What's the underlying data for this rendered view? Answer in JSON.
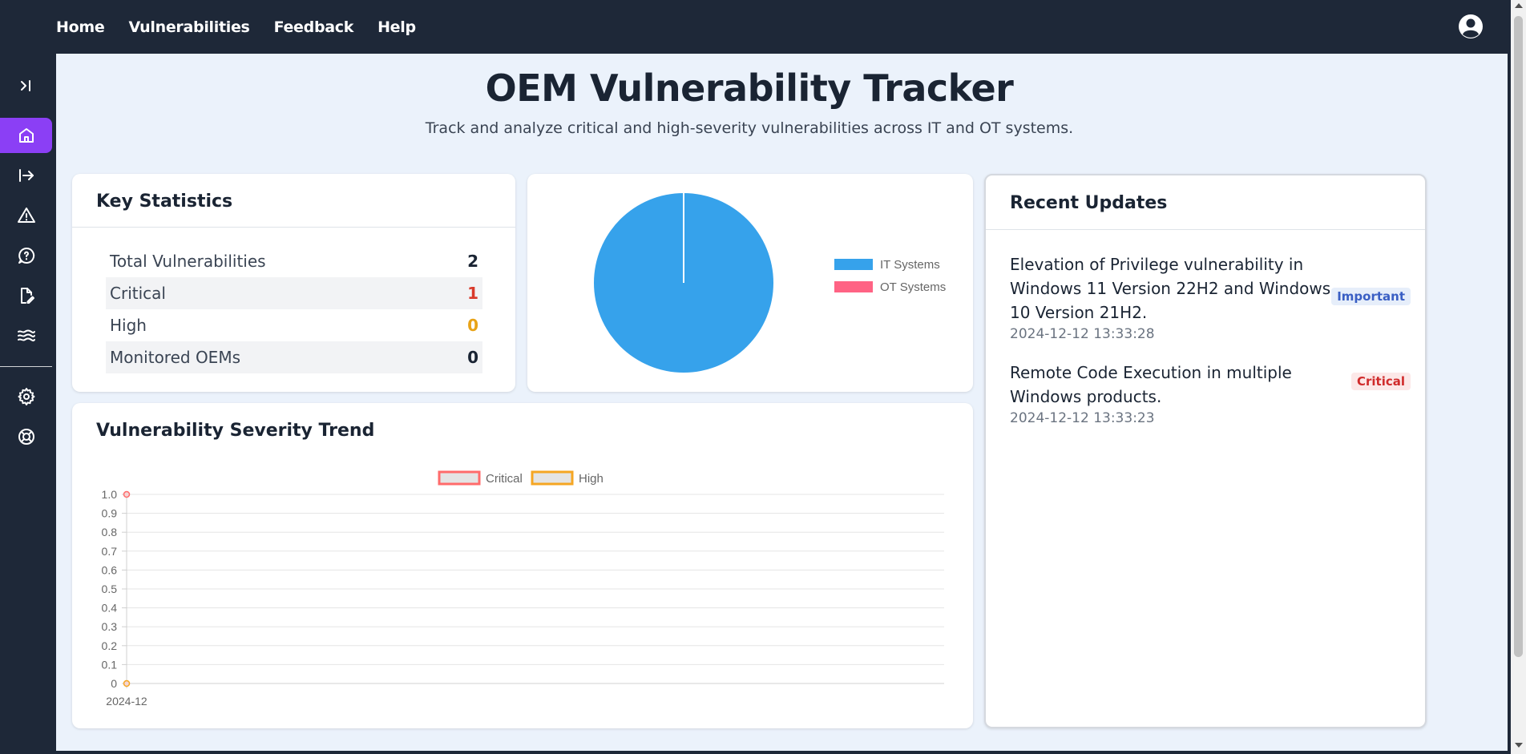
{
  "nav": {
    "items": [
      {
        "label": "Home"
      },
      {
        "label": "Vulnerabilities"
      },
      {
        "label": "Feedback"
      },
      {
        "label": "Help"
      }
    ],
    "user_icon": "user-circle-icon"
  },
  "sidebar": {
    "items": [
      {
        "icon": "expand-sidebar-icon"
      },
      {
        "icon": "home-icon",
        "active": true
      },
      {
        "icon": "logout-arrow-icon"
      },
      {
        "icon": "alert-triangle-icon"
      },
      {
        "icon": "feedback-bubble-icon"
      },
      {
        "icon": "file-edit-icon"
      },
      {
        "icon": "waves-icon"
      },
      {
        "icon": "settings-gear-icon"
      },
      {
        "icon": "help-lifebuoy-icon"
      }
    ],
    "active_color": "#8b3ff5"
  },
  "page": {
    "title": "OEM Vulnerability Tracker",
    "subtitle": "Track and analyze critical and high-severity vulnerabilities across IT and OT systems."
  },
  "key_statistics": {
    "heading": "Key Statistics",
    "rows": [
      {
        "label": "Total Vulnerabilities",
        "value": "2",
        "color": "#1a2433"
      },
      {
        "label": "Critical",
        "value": "1",
        "color": "#d93a2b"
      },
      {
        "label": "High",
        "value": "0",
        "color": "#e8a317"
      },
      {
        "label": "Monitored OEMs",
        "value": "0",
        "color": "#1a2433"
      }
    ]
  },
  "recent_updates": {
    "heading": "Recent Updates",
    "items": [
      {
        "title": "Elevation of Privilege vulnerability in Windows 11 Version 22H2 and Windows 10 Version 21H2.",
        "date": "2024-12-12 13:33:28",
        "badge": "Important"
      },
      {
        "title": "Remote Code Execution in multiple Windows products.",
        "date": "2024-12-12 13:33:23",
        "badge": "Critical"
      }
    ]
  },
  "trend_card": {
    "heading": "Vulnerability Severity Trend"
  },
  "chart_data": [
    {
      "type": "pie",
      "labels": [
        "IT Systems",
        "OT Systems"
      ],
      "values": [
        2,
        0
      ],
      "colors": [
        "#36a2eb",
        "#ff6384"
      ],
      "legend_position": "right"
    },
    {
      "type": "line",
      "categories": [
        "2024-12"
      ],
      "series": [
        {
          "name": "Critical",
          "values": [
            1
          ],
          "color": "#ff6b6b"
        },
        {
          "name": "High",
          "values": [
            0
          ],
          "color": "#f5a623"
        }
      ],
      "yticks": [
        "1.0",
        "0.9",
        "0.8",
        "0.7",
        "0.6",
        "0.5",
        "0.4",
        "0.3",
        "0.2",
        "0.1",
        "0"
      ],
      "ylim": [
        0,
        1
      ],
      "grid": true,
      "legend_position": "top"
    }
  ]
}
